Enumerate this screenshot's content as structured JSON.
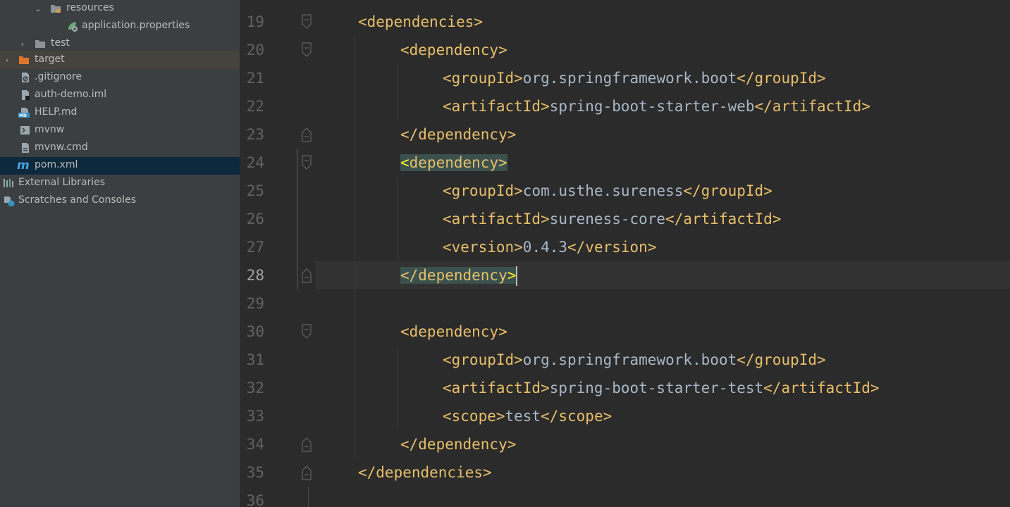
{
  "project_tree": {
    "items": [
      {
        "label": "resources",
        "icon": "folder-resources-icon",
        "expanded": true
      },
      {
        "label": "application.properties",
        "icon": "spring-properties-icon"
      },
      {
        "label": "test",
        "icon": "folder-icon",
        "expanded": false
      },
      {
        "label": "target",
        "icon": "folder-excluded-icon",
        "expanded": false
      },
      {
        "label": ".gitignore",
        "icon": "gitignore-file-icon"
      },
      {
        "label": "auth-demo.iml",
        "icon": "iml-file-icon"
      },
      {
        "label": "HELP.md",
        "icon": "markdown-file-icon"
      },
      {
        "label": "mvnw",
        "icon": "shell-script-icon"
      },
      {
        "label": "mvnw.cmd",
        "icon": "cmd-file-icon"
      },
      {
        "label": "pom.xml",
        "icon": "maven-icon",
        "selected": true
      },
      {
        "label": "External Libraries",
        "icon": "libraries-icon"
      },
      {
        "label": "Scratches and Consoles",
        "icon": "scratches-icon"
      }
    ]
  },
  "editor": {
    "current_line": 28,
    "lines": [
      {
        "num": "19",
        "open": "<dependencies>"
      },
      {
        "num": "20",
        "open": "<dependency>"
      },
      {
        "num": "21",
        "open": "<groupId>",
        "value": "org.springframework.boot",
        "close": "</groupId>"
      },
      {
        "num": "22",
        "open": "<artifactId>",
        "value": "spring-boot-starter-web",
        "close": "</artifactId>"
      },
      {
        "num": "23",
        "open": "</dependency>"
      },
      {
        "num": "24",
        "open": "dependency>",
        "bracket": "<"
      },
      {
        "num": "25",
        "open": "<groupId>",
        "value": "com.usthe.sureness",
        "close": "</groupId>"
      },
      {
        "num": "26",
        "open": "<artifactId>",
        "value": "sureness-core",
        "close": "</artifactId>"
      },
      {
        "num": "27",
        "open": "<version>",
        "value": "0.4.3",
        "close": "</version>"
      },
      {
        "num": "28",
        "open": "</dependency",
        "bracket": ">"
      },
      {
        "num": "29",
        "open": ""
      },
      {
        "num": "30",
        "open": "<dependency>"
      },
      {
        "num": "31",
        "open": "<groupId>",
        "value": "org.springframework.boot",
        "close": "</groupId>"
      },
      {
        "num": "32",
        "open": "<artifactId>",
        "value": "spring-boot-starter-test",
        "close": "</artifactId>"
      },
      {
        "num": "33",
        "open": "<scope>",
        "value": "test",
        "close": "</scope>"
      },
      {
        "num": "34",
        "open": "</dependency>"
      },
      {
        "num": "35",
        "open": "</dependencies>"
      },
      {
        "num": "36",
        "open": ""
      }
    ]
  },
  "colors": {
    "sidebar_bg": "#3c3f41",
    "editor_bg": "#2b2b2b",
    "tag": "#e8bf6a",
    "text": "#a9b7c6",
    "matched_tag_bg": "#3b514d",
    "matched_bracket": "#ffef28",
    "selected_row": "#0d293e"
  }
}
